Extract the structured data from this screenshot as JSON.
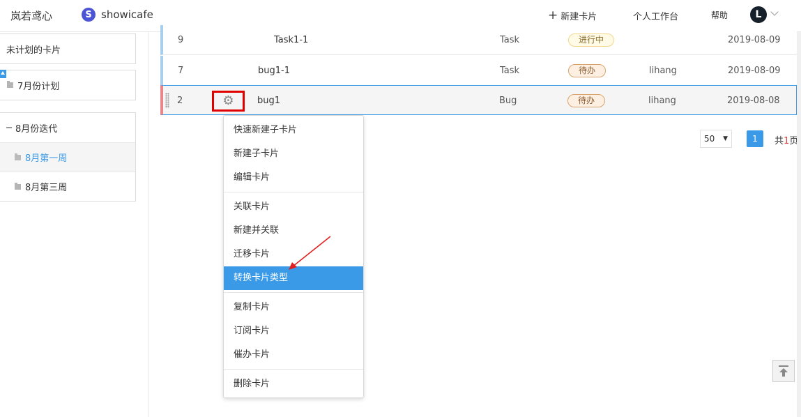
{
  "header": {
    "brand": "岚若鸢心",
    "project_logo_letter": "S",
    "project_name": "showicafe",
    "new_card_label": "新建卡片",
    "workspace_label": "个人工作台",
    "help_label": "帮助",
    "avatar_letter": "L"
  },
  "sidebar": {
    "unplanned": "未计划的卡片",
    "july_plan": "7月份计划",
    "aug_iteration": "8月份迭代",
    "aug_week1": "8月第一周",
    "aug_week3": "8月第三周"
  },
  "rows": [
    {
      "id": "9",
      "title": "Task1-1",
      "type": "Task",
      "status": "进行中",
      "owner": "",
      "date": "2019-08-09"
    },
    {
      "id": "7",
      "title": "bug1-1",
      "type": "Task",
      "status": "待办",
      "owner": "lihang",
      "date": "2019-08-09"
    },
    {
      "id": "2",
      "title": "bug1",
      "type": "Bug",
      "status": "待办",
      "owner": "lihang",
      "date": "2019-08-08"
    }
  ],
  "pagination": {
    "page_size": "50",
    "current_page": "1",
    "total_prefix": "共",
    "total_pages": "1",
    "total_suffix": "页"
  },
  "context_menu": {
    "quick_new_child": "快速新建子卡片",
    "new_child": "新建子卡片",
    "edit": "编辑卡片",
    "link": "关联卡片",
    "new_and_link": "新建并关联",
    "migrate": "迁移卡片",
    "convert_type": "转换卡片类型",
    "copy": "复制卡片",
    "subscribe": "订阅卡片",
    "urge": "催办卡片",
    "delete": "删除卡片"
  },
  "colors": {
    "accent": "#3a9ae8",
    "highlight_box": "#e00000",
    "annotation_arrow": "#e02020"
  },
  "icons": {
    "row_action": "gear-icon",
    "add": "plus-icon",
    "back_to_top": "back-to-top-icon"
  }
}
